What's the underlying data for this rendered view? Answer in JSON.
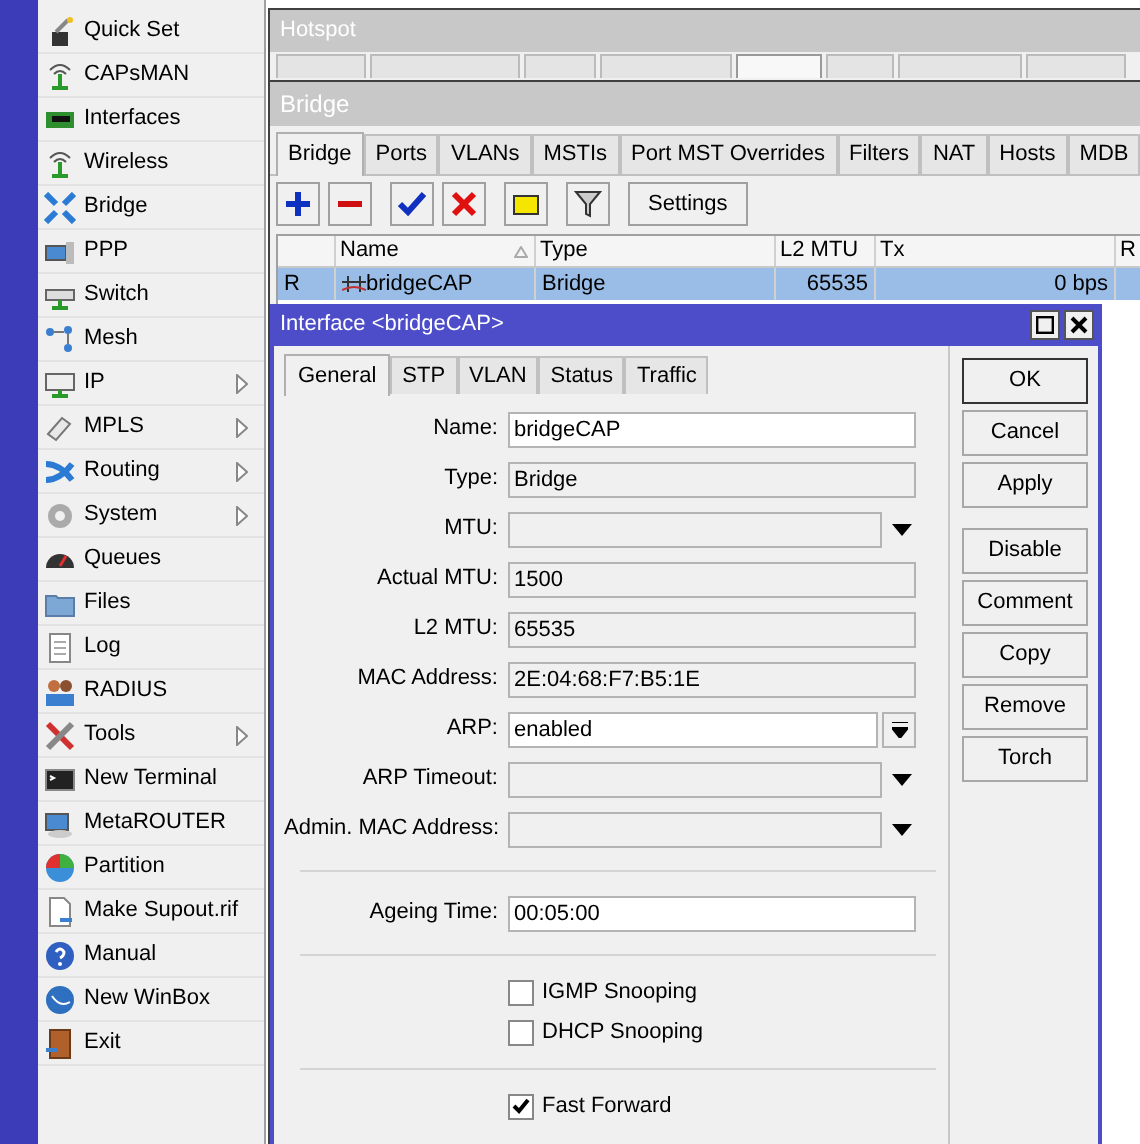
{
  "sidebar": {
    "items": [
      {
        "label": "Quick Set",
        "submenu": false
      },
      {
        "label": "CAPsMAN",
        "submenu": false
      },
      {
        "label": "Interfaces",
        "submenu": false
      },
      {
        "label": "Wireless",
        "submenu": false
      },
      {
        "label": "Bridge",
        "submenu": false
      },
      {
        "label": "PPP",
        "submenu": false
      },
      {
        "label": "Switch",
        "submenu": false
      },
      {
        "label": "Mesh",
        "submenu": false
      },
      {
        "label": "IP",
        "submenu": true
      },
      {
        "label": "MPLS",
        "submenu": true
      },
      {
        "label": "Routing",
        "submenu": true
      },
      {
        "label": "System",
        "submenu": true
      },
      {
        "label": "Queues",
        "submenu": false
      },
      {
        "label": "Files",
        "submenu": false
      },
      {
        "label": "Log",
        "submenu": false
      },
      {
        "label": "RADIUS",
        "submenu": false
      },
      {
        "label": "Tools",
        "submenu": true
      },
      {
        "label": "New Terminal",
        "submenu": false
      },
      {
        "label": "MetaROUTER",
        "submenu": false
      },
      {
        "label": "Partition",
        "submenu": false
      },
      {
        "label": "Make Supout.rif",
        "submenu": false
      },
      {
        "label": "Manual",
        "submenu": false
      },
      {
        "label": "New WinBox",
        "submenu": false
      },
      {
        "label": "Exit",
        "submenu": false
      }
    ]
  },
  "hotspot_window": {
    "title": "Hotspot",
    "tabs": [
      {
        "selected": false
      },
      {
        "selected": false
      },
      {
        "selected": false
      },
      {
        "selected": false
      },
      {
        "selected": true
      },
      {
        "selected": false
      },
      {
        "selected": false
      },
      {
        "selected": false
      }
    ]
  },
  "bridge_window": {
    "title": "Bridge",
    "tabs": [
      {
        "label": "Bridge",
        "selected": true
      },
      {
        "label": "Ports",
        "selected": false
      },
      {
        "label": "VLANs",
        "selected": false
      },
      {
        "label": "MSTIs",
        "selected": false
      },
      {
        "label": "Port MST Overrides",
        "selected": false
      },
      {
        "label": "Filters",
        "selected": false
      },
      {
        "label": "NAT",
        "selected": false
      },
      {
        "label": "Hosts",
        "selected": false
      },
      {
        "label": "MDB",
        "selected": false
      }
    ],
    "settings_button": "Settings",
    "table": {
      "columns": [
        {
          "sorted": false
        },
        {
          "label": "Name",
          "sorted": true
        },
        {
          "label": "Type",
          "sorted": false
        },
        {
          "label": "L2 MTU",
          "sorted": false
        },
        {
          "label": "Tx",
          "sorted": false
        },
        {
          "label": "R",
          "sorted": false
        }
      ],
      "rows": [
        {
          "flag": "R",
          "name": "bridgeCAP",
          "type": "Bridge",
          "l2_mtu": "65535",
          "tx": "0 bps",
          "selected": true
        }
      ]
    }
  },
  "dialog": {
    "title": "Interface <bridgeCAP>",
    "tabs": [
      {
        "label": "General",
        "selected": true
      },
      {
        "label": "STP",
        "selected": false
      },
      {
        "label": "VLAN",
        "selected": false
      },
      {
        "label": "Status",
        "selected": false
      },
      {
        "label": "Traffic",
        "selected": false
      }
    ],
    "fields": [
      {
        "kind": "text",
        "label": "Name:",
        "value": "bridgeCAP"
      },
      {
        "kind": "readonly",
        "label": "Type:",
        "value": "Bridge"
      },
      {
        "kind": "dropdown",
        "label": "MTU:"
      },
      {
        "kind": "readonly",
        "label": "Actual MTU:",
        "value": "1500"
      },
      {
        "kind": "readonly",
        "label": "L2 MTU:",
        "value": "65535"
      },
      {
        "kind": "readonly",
        "label": "MAC Address:",
        "value": "2E:04:68:F7:B5:1E"
      },
      {
        "kind": "select",
        "label": "ARP:",
        "value": "enabled"
      },
      {
        "kind": "dropdown",
        "label": "ARP Timeout:"
      },
      {
        "kind": "dropdown",
        "label": "Admin. MAC Address:"
      },
      {
        "kind": "separator"
      },
      {
        "kind": "text",
        "label": "Ageing Time:",
        "value": "00:05:00"
      },
      {
        "kind": "separator"
      },
      {
        "kind": "checkbox",
        "label": "IGMP Snooping",
        "checked": false
      },
      {
        "kind": "checkbox",
        "label": "DHCP Snooping",
        "checked": false
      },
      {
        "kind": "separator"
      },
      {
        "kind": "checkbox",
        "label": "Fast Forward",
        "checked": true
      }
    ],
    "buttons": [
      {
        "label": "OK",
        "default": true
      },
      {
        "label": "Cancel",
        "default": false
      },
      {
        "label": "Apply",
        "default": false
      }
    ],
    "action_buttons": [
      {
        "label": "Disable"
      },
      {
        "label": "Comment"
      },
      {
        "label": "Copy"
      },
      {
        "label": "Remove"
      },
      {
        "label": "Torch"
      }
    ]
  }
}
